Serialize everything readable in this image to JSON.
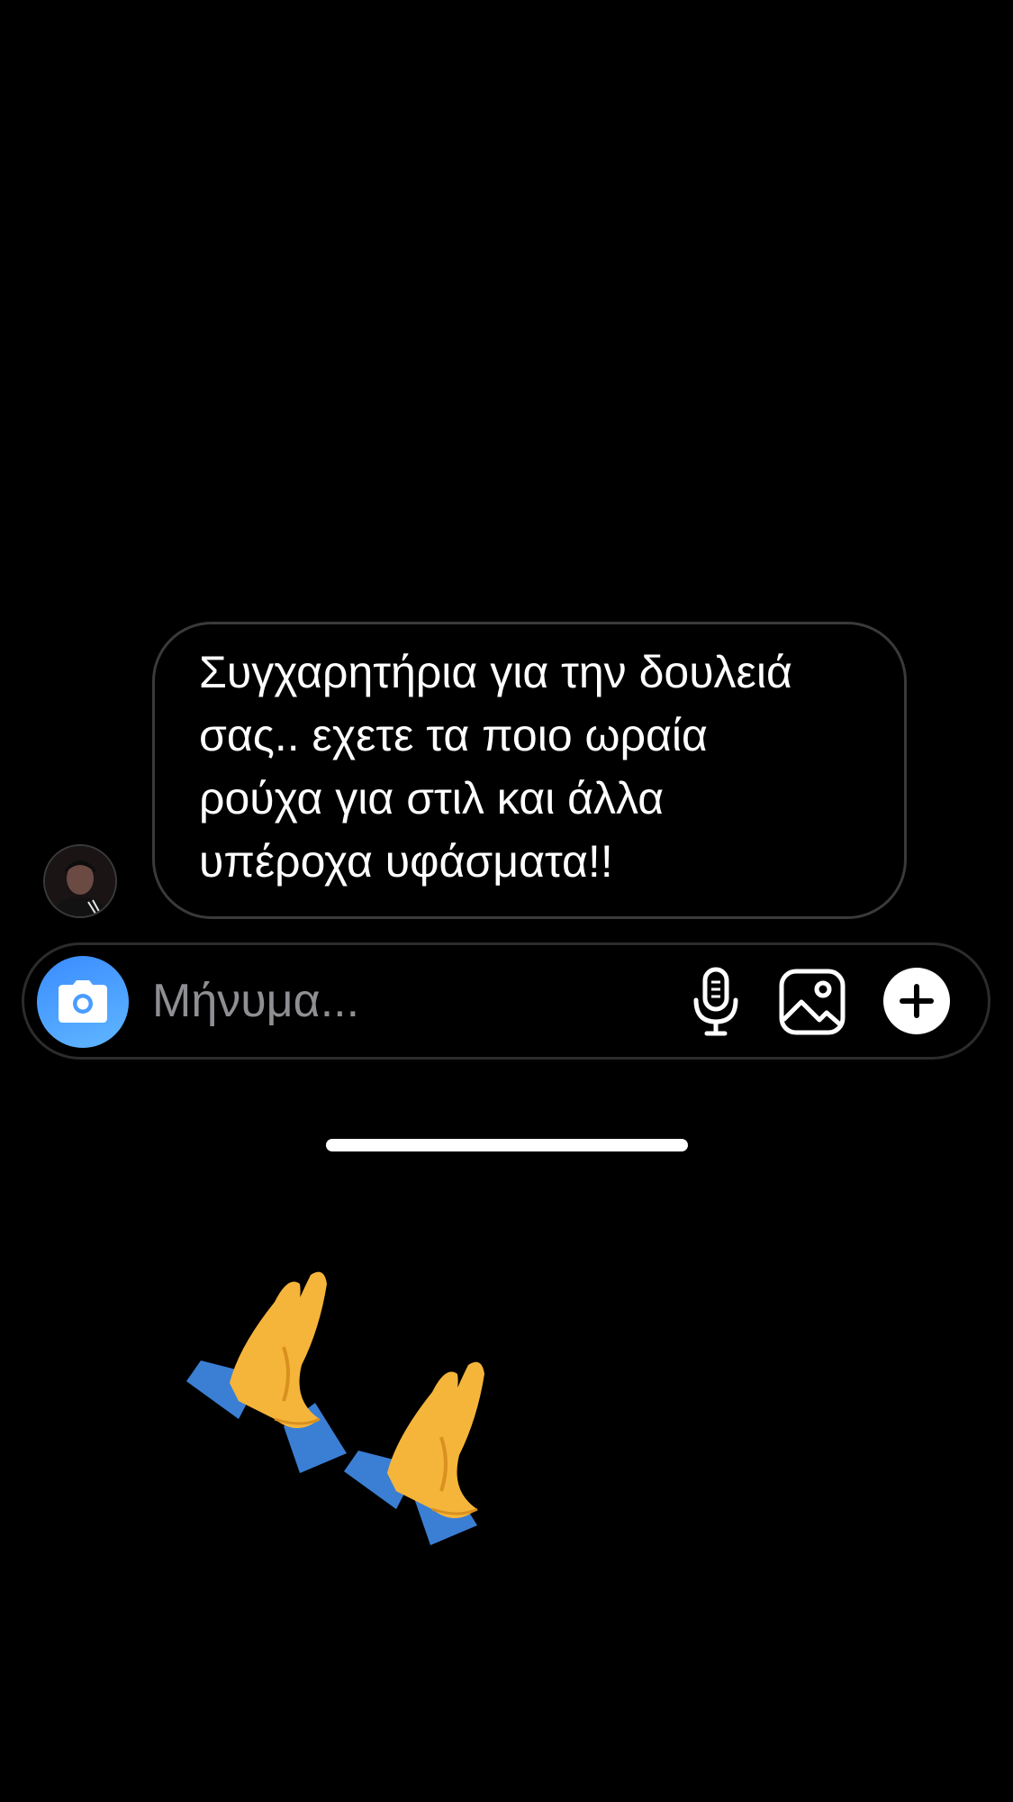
{
  "message": {
    "text": "Συγχαρητήρια για την δουλειά\nσας.. εχετε τα ποιο ωραία\nρούχα για στιλ και άλλα\nυπέροχα υφάσματα!!",
    "sender_avatar": "avatar"
  },
  "composer": {
    "placeholder": "Μήνυμα...",
    "value": "",
    "camera_icon": "camera-icon",
    "mic_icon": "microphone-icon",
    "gallery_icon": "gallery-icon",
    "plus_icon": "plus-icon"
  },
  "reaction": {
    "emoji": "🙏🙏",
    "icon": "folded-hands-icon"
  },
  "colors": {
    "background": "#000000",
    "bubble_border": "#3a3a3c",
    "camera_accent": "#3a8cff",
    "placeholder": "#8e8e93"
  }
}
